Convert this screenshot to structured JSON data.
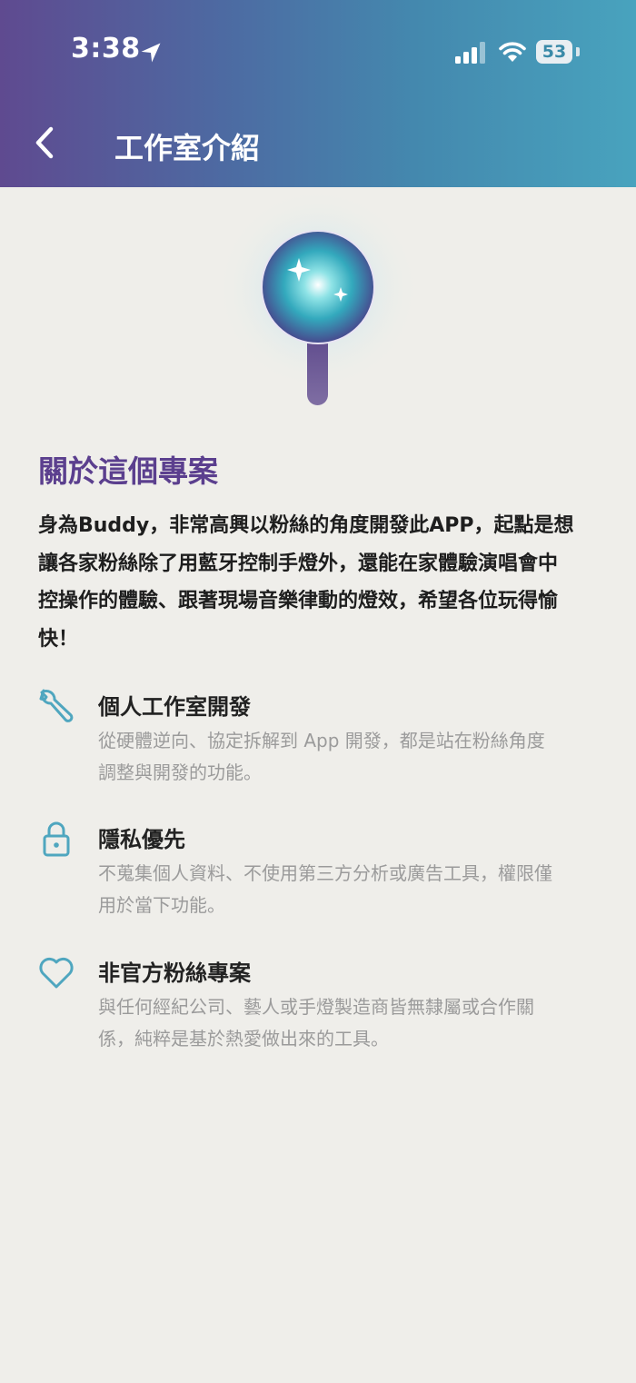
{
  "status_bar": {
    "time": "3:38",
    "battery": "53",
    "icons": [
      "location-arrow-icon",
      "signal-icon",
      "wifi-icon",
      "battery-icon"
    ]
  },
  "header": {
    "title": "工作室介紹",
    "back_icon": "chevron-left-icon",
    "gradient_colors": [
      "#5f4a90",
      "#48a3be"
    ]
  },
  "hero": {
    "icon": "glowing-lightstick-icon",
    "colors": {
      "orb_center": "#ffffff",
      "orb_mid": "#3fb9c6",
      "orb_edge": "#4a3a86",
      "handle": "#6d5a92"
    }
  },
  "about": {
    "title": "關於這個專案",
    "intro_line1": "身為Buddy，非常高興以粉絲的角度開發此APP，起點是想",
    "intro_line2": "讓各家粉絲除了用藍牙控制手燈外，還能在家體驗演唱會中",
    "intro_line3": "控操作的體驗、跟著現場音樂律動的燈效，希望各位玩得愉",
    "intro_line4": "快！"
  },
  "features": [
    {
      "icon": "wrench-icon",
      "title": "個人工作室開發",
      "desc_line1": "從硬體逆向、協定拆解到 App 開發，都是站在粉絲角度",
      "desc_line2": "調整與開發的功能。"
    },
    {
      "icon": "lock-icon",
      "title": "隱私優先",
      "desc_line1": "不蒐集個人資料、不使用第三方分析或廣告工具，權限僅",
      "desc_line2": "用於當下功能。"
    },
    {
      "icon": "heart-icon",
      "title": "非官方粉絲專案",
      "desc_line1": "與任何經紀公司、藝人或手燈製造商皆無隸屬或合作關",
      "desc_line2": "係，純粹是基於熱愛做出來的工具。"
    }
  ],
  "colors": {
    "accent_purple": "#5b3f8e",
    "accent_teal": "#4fa6bf",
    "background": "#efeeea",
    "muted_text": "#9b9b9b"
  }
}
